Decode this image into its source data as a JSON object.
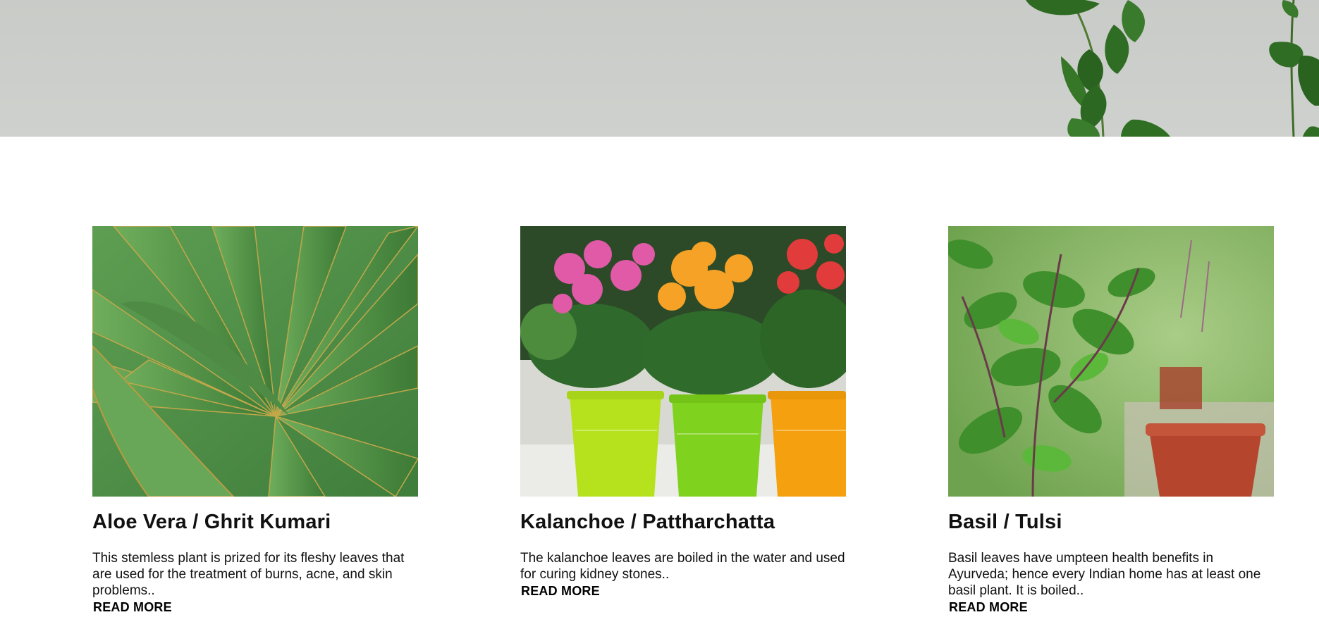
{
  "cards": [
    {
      "title": "Aloe Vera / Ghrit Kumari",
      "description": "This stemless plant is prized for its fleshy leaves that are used for the treatment of burns, acne, and skin problems..",
      "link": "READ MORE"
    },
    {
      "title": "Kalanchoe / Pattharchatta",
      "description": "The kalanchoe leaves are boiled in the water and used for curing kidney stones..",
      "link": "READ MORE"
    },
    {
      "title": "Basil / Tulsi",
      "description": "Basil leaves have umpteen health benefits in Ayurveda; hence every Indian home has at least one basil plant. It is boiled..",
      "link": "READ MORE"
    }
  ],
  "colors": {
    "hero_bg": "#cbcdca",
    "text": "#111111",
    "leaf": "#2f6b25"
  },
  "icons": [
    "pothos-vine-decoration"
  ]
}
